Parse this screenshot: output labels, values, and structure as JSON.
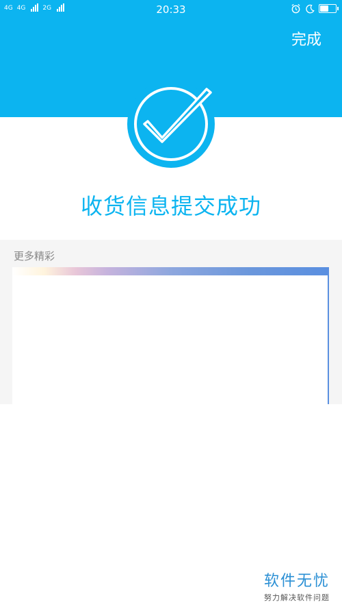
{
  "status_bar": {
    "network_1": "4G",
    "network_2": "4G",
    "network_3": "2G",
    "time": "20:33",
    "alarm_icon": "alarm-clock-icon",
    "moon_icon": "moon-icon",
    "battery_level": 0.55
  },
  "header": {
    "done_label": "完成"
  },
  "success": {
    "icon": "check-circle-icon",
    "title": "收货信息提交成功"
  },
  "more": {
    "label": "更多精彩"
  },
  "watermark": {
    "main": "软件无忧",
    "sub": "努力解决软件问题"
  },
  "colors": {
    "brand": "#0cb4f0",
    "section_bg": "#f5f5f5",
    "card_border": "#5a8fe0"
  }
}
